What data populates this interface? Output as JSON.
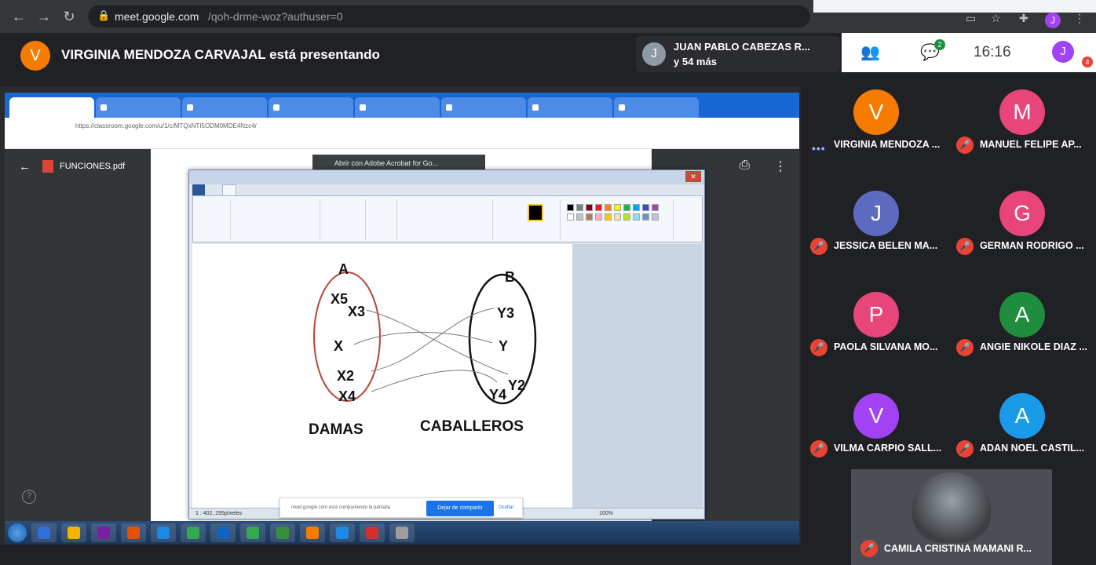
{
  "browser": {
    "url_host": "meet.google.com",
    "url_path": "/qoh-drme-woz?authuser=0",
    "profile_initial": "J"
  },
  "meet": {
    "presenter_initial": "V",
    "presenter_text": "VIRGINIA MENDOZA CARVAJAL está presentando",
    "people_pill": {
      "initial": "J",
      "name": "JUAN PABLO CABEZAS R...",
      "more": "y 54 más"
    },
    "chat_badge": "2",
    "clock": "16:16",
    "self_initial": "J",
    "self_badge": "4"
  },
  "participants": [
    {
      "initial": "V",
      "name": "VIRGINIA MENDOZA ...",
      "color": "#f57c00",
      "muted": false
    },
    {
      "initial": "M",
      "name": "MANUEL FELIPE AP...",
      "color": "#e8457a",
      "muted": true
    },
    {
      "initial": "J",
      "name": "JESSICA BELEN MA...",
      "color": "#5c6bc0",
      "muted": true
    },
    {
      "initial": "G",
      "name": "GERMAN RODRIGO ...",
      "color": "#e8457a",
      "muted": true
    },
    {
      "initial": "P",
      "name": "PAOLA SILVANA MO...",
      "color": "#e8457a",
      "muted": true
    },
    {
      "initial": "A",
      "name": "ANGIE NIKOLE DIAZ ...",
      "color": "#1e8e3e",
      "muted": true
    },
    {
      "initial": "V",
      "name": "VILMA CARPIO SALL...",
      "color": "#a142f4",
      "muted": true
    },
    {
      "initial": "A",
      "name": "ADAN NOEL CASTIL...",
      "color": "#1a9be8",
      "muted": true
    }
  ],
  "camila_name": "CAMILA CRISTINA MAMANI R...",
  "shared": {
    "pdf_title": "FUNCIONES.pdf",
    "adobe_pill": "Abrir con Adobe Acrobat for Go...",
    "inner_url": "https://classroom.google.com/u/1/c/MTQxNTI5ODM0MDE4Nzc4/",
    "share_text": "meet.google.com está compartiendo la pantalla",
    "share_stop": "Dejar de compartir",
    "share_hide": "Ocultar",
    "paint_status": "1 : 402, 295píxeles",
    "paint_zoom": "100%",
    "diagram": {
      "set_a_label": "A",
      "set_b_label": "B",
      "set_a_items": [
        "X5",
        "X3",
        "X",
        "X2",
        "X4"
      ],
      "set_b_items": [
        "Y3",
        "Y",
        "Y2",
        "Y4"
      ],
      "set_a_name": "DAMAS",
      "set_b_name": "CABALLEROS",
      "set_a_color": "#b5473a",
      "set_b_color": "#111111"
    }
  },
  "colors": {
    "meet_bg": "#202124",
    "accent_blue": "#1a73e8",
    "mute_red": "#ea4335"
  }
}
